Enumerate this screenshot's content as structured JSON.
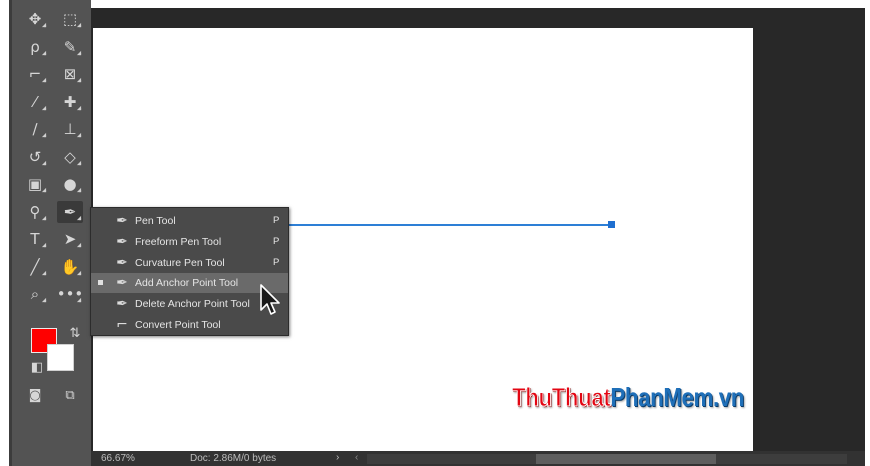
{
  "toolbar": {
    "tools": [
      {
        "name": "move-tool-icon",
        "glyph": "✥"
      },
      {
        "name": "marquee-tool-icon",
        "glyph": "⬚"
      },
      {
        "name": "lasso-tool-icon",
        "glyph": "ρ"
      },
      {
        "name": "quick-select-tool-icon",
        "glyph": "✎"
      },
      {
        "name": "crop-tool-icon",
        "glyph": "⌐"
      },
      {
        "name": "frame-tool-icon",
        "glyph": "⊠"
      },
      {
        "name": "eyedropper-tool-icon",
        "glyph": "⁄"
      },
      {
        "name": "healing-brush-tool-icon",
        "glyph": "✚"
      },
      {
        "name": "brush-tool-icon",
        "glyph": "∕"
      },
      {
        "name": "clone-stamp-tool-icon",
        "glyph": "⊥"
      },
      {
        "name": "history-brush-tool-icon",
        "glyph": "↺"
      },
      {
        "name": "eraser-tool-icon",
        "glyph": "◇"
      },
      {
        "name": "gradient-tool-icon",
        "glyph": "▣"
      },
      {
        "name": "blur-tool-icon",
        "glyph": "●"
      },
      {
        "name": "dodge-tool-icon",
        "glyph": "⚲"
      },
      {
        "name": "pen-tool-icon",
        "glyph": "✒"
      },
      {
        "name": "type-tool-icon",
        "glyph": "T"
      },
      {
        "name": "path-selection-tool-icon",
        "glyph": "➤"
      },
      {
        "name": "line-tool-icon",
        "glyph": "╱"
      },
      {
        "name": "hand-tool-icon",
        "glyph": "✋"
      },
      {
        "name": "zoom-tool-icon",
        "glyph": "⌕"
      },
      {
        "name": "more-tools-icon",
        "glyph": "•••"
      }
    ],
    "swap_glyph": "⇅",
    "default_glyph": "◧",
    "quick_mask_glyph": "◙",
    "screen_mode_glyph": "⧉",
    "colors": {
      "foreground": "#ff0000",
      "background": "#ffffff"
    }
  },
  "flyout": {
    "items": [
      {
        "label": "Pen Tool",
        "shortcut": "P",
        "icon": "pen-icon",
        "glyph": "✒"
      },
      {
        "label": "Freeform Pen Tool",
        "shortcut": "P",
        "icon": "freeform-pen-icon",
        "glyph": "✒"
      },
      {
        "label": "Curvature Pen Tool",
        "shortcut": "P",
        "icon": "curvature-pen-icon",
        "glyph": "✒"
      },
      {
        "label": "Add Anchor Point Tool",
        "shortcut": "",
        "icon": "add-anchor-point-icon",
        "glyph": "✒"
      },
      {
        "label": "Delete Anchor Point Tool",
        "shortcut": "",
        "icon": "delete-anchor-point-icon",
        "glyph": "✒"
      },
      {
        "label": "Convert Point Tool",
        "shortcut": "",
        "icon": "convert-point-icon",
        "glyph": "⌐"
      }
    ],
    "selected_label": "Add Anchor Point Tool"
  },
  "status_bar": {
    "zoom": "66.67%",
    "doc": "Doc: 2.86M/0 bytes",
    "arrow": "›",
    "scroll_left": "‹"
  },
  "watermark": {
    "part1": "ThuThuat",
    "part2": "PhanMem.vn"
  },
  "path_color": "#2d7fd6"
}
